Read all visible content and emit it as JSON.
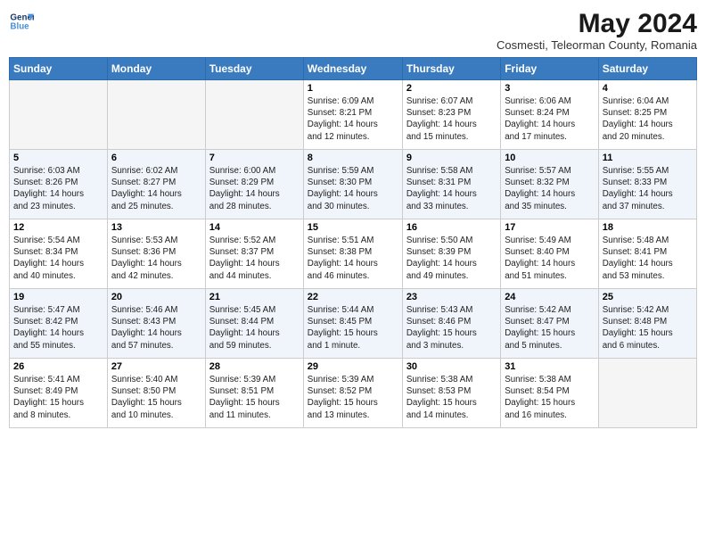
{
  "header": {
    "logo_line1": "General",
    "logo_line2": "Blue",
    "month": "May 2024",
    "location": "Cosmesti, Teleorman County, Romania"
  },
  "days_of_week": [
    "Sunday",
    "Monday",
    "Tuesday",
    "Wednesday",
    "Thursday",
    "Friday",
    "Saturday"
  ],
  "weeks": [
    [
      {
        "day": "",
        "info": ""
      },
      {
        "day": "",
        "info": ""
      },
      {
        "day": "",
        "info": ""
      },
      {
        "day": "1",
        "info": "Sunrise: 6:09 AM\nSunset: 8:21 PM\nDaylight: 14 hours\nand 12 minutes."
      },
      {
        "day": "2",
        "info": "Sunrise: 6:07 AM\nSunset: 8:23 PM\nDaylight: 14 hours\nand 15 minutes."
      },
      {
        "day": "3",
        "info": "Sunrise: 6:06 AM\nSunset: 8:24 PM\nDaylight: 14 hours\nand 17 minutes."
      },
      {
        "day": "4",
        "info": "Sunrise: 6:04 AM\nSunset: 8:25 PM\nDaylight: 14 hours\nand 20 minutes."
      }
    ],
    [
      {
        "day": "5",
        "info": "Sunrise: 6:03 AM\nSunset: 8:26 PM\nDaylight: 14 hours\nand 23 minutes."
      },
      {
        "day": "6",
        "info": "Sunrise: 6:02 AM\nSunset: 8:27 PM\nDaylight: 14 hours\nand 25 minutes."
      },
      {
        "day": "7",
        "info": "Sunrise: 6:00 AM\nSunset: 8:29 PM\nDaylight: 14 hours\nand 28 minutes."
      },
      {
        "day": "8",
        "info": "Sunrise: 5:59 AM\nSunset: 8:30 PM\nDaylight: 14 hours\nand 30 minutes."
      },
      {
        "day": "9",
        "info": "Sunrise: 5:58 AM\nSunset: 8:31 PM\nDaylight: 14 hours\nand 33 minutes."
      },
      {
        "day": "10",
        "info": "Sunrise: 5:57 AM\nSunset: 8:32 PM\nDaylight: 14 hours\nand 35 minutes."
      },
      {
        "day": "11",
        "info": "Sunrise: 5:55 AM\nSunset: 8:33 PM\nDaylight: 14 hours\nand 37 minutes."
      }
    ],
    [
      {
        "day": "12",
        "info": "Sunrise: 5:54 AM\nSunset: 8:34 PM\nDaylight: 14 hours\nand 40 minutes."
      },
      {
        "day": "13",
        "info": "Sunrise: 5:53 AM\nSunset: 8:36 PM\nDaylight: 14 hours\nand 42 minutes."
      },
      {
        "day": "14",
        "info": "Sunrise: 5:52 AM\nSunset: 8:37 PM\nDaylight: 14 hours\nand 44 minutes."
      },
      {
        "day": "15",
        "info": "Sunrise: 5:51 AM\nSunset: 8:38 PM\nDaylight: 14 hours\nand 46 minutes."
      },
      {
        "day": "16",
        "info": "Sunrise: 5:50 AM\nSunset: 8:39 PM\nDaylight: 14 hours\nand 49 minutes."
      },
      {
        "day": "17",
        "info": "Sunrise: 5:49 AM\nSunset: 8:40 PM\nDaylight: 14 hours\nand 51 minutes."
      },
      {
        "day": "18",
        "info": "Sunrise: 5:48 AM\nSunset: 8:41 PM\nDaylight: 14 hours\nand 53 minutes."
      }
    ],
    [
      {
        "day": "19",
        "info": "Sunrise: 5:47 AM\nSunset: 8:42 PM\nDaylight: 14 hours\nand 55 minutes."
      },
      {
        "day": "20",
        "info": "Sunrise: 5:46 AM\nSunset: 8:43 PM\nDaylight: 14 hours\nand 57 minutes."
      },
      {
        "day": "21",
        "info": "Sunrise: 5:45 AM\nSunset: 8:44 PM\nDaylight: 14 hours\nand 59 minutes."
      },
      {
        "day": "22",
        "info": "Sunrise: 5:44 AM\nSunset: 8:45 PM\nDaylight: 15 hours\nand 1 minute."
      },
      {
        "day": "23",
        "info": "Sunrise: 5:43 AM\nSunset: 8:46 PM\nDaylight: 15 hours\nand 3 minutes."
      },
      {
        "day": "24",
        "info": "Sunrise: 5:42 AM\nSunset: 8:47 PM\nDaylight: 15 hours\nand 5 minutes."
      },
      {
        "day": "25",
        "info": "Sunrise: 5:42 AM\nSunset: 8:48 PM\nDaylight: 15 hours\nand 6 minutes."
      }
    ],
    [
      {
        "day": "26",
        "info": "Sunrise: 5:41 AM\nSunset: 8:49 PM\nDaylight: 15 hours\nand 8 minutes."
      },
      {
        "day": "27",
        "info": "Sunrise: 5:40 AM\nSunset: 8:50 PM\nDaylight: 15 hours\nand 10 minutes."
      },
      {
        "day": "28",
        "info": "Sunrise: 5:39 AM\nSunset: 8:51 PM\nDaylight: 15 hours\nand 11 minutes."
      },
      {
        "day": "29",
        "info": "Sunrise: 5:39 AM\nSunset: 8:52 PM\nDaylight: 15 hours\nand 13 minutes."
      },
      {
        "day": "30",
        "info": "Sunrise: 5:38 AM\nSunset: 8:53 PM\nDaylight: 15 hours\nand 14 minutes."
      },
      {
        "day": "31",
        "info": "Sunrise: 5:38 AM\nSunset: 8:54 PM\nDaylight: 15 hours\nand 16 minutes."
      },
      {
        "day": "",
        "info": ""
      }
    ]
  ]
}
